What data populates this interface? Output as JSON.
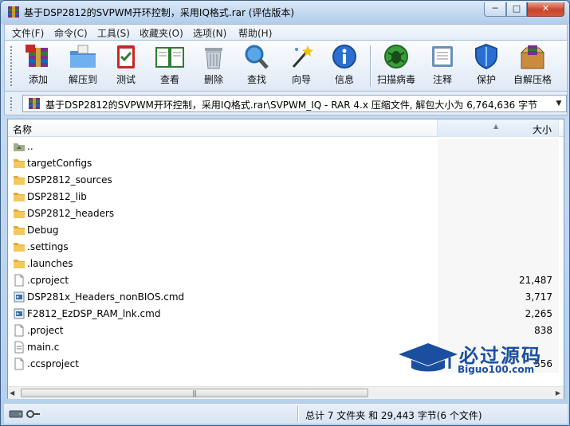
{
  "window": {
    "title": "基于DSP2812的SVPWM开环控制，采用IQ格式.rar (评估版本)",
    "controls": {
      "minimize": "─",
      "maximize": "□",
      "close": "✕"
    }
  },
  "menu": [
    "文件(F)",
    "命令(C)",
    "工具(S)",
    "收藏夹(O)",
    "选项(N)",
    "帮助(H)"
  ],
  "toolbar": [
    {
      "label": "添加",
      "icon": "add-archive-icon"
    },
    {
      "label": "解压到",
      "icon": "extract-folder-icon"
    },
    {
      "label": "测试",
      "icon": "test-clipboard-icon"
    },
    {
      "label": "查看",
      "icon": "view-book-icon"
    },
    {
      "label": "删除",
      "icon": "trash-icon"
    },
    {
      "label": "查找",
      "icon": "search-icon"
    },
    {
      "label": "向导",
      "icon": "wizard-wand-icon"
    },
    {
      "label": "信息",
      "icon": "info-icon"
    },
    {
      "label": "扫描病毒",
      "icon": "virus-scan-icon"
    },
    {
      "label": "注释",
      "icon": "comment-icon"
    },
    {
      "label": "保护",
      "icon": "shield-icon"
    },
    {
      "label": "自解压格",
      "icon": "sfx-box-icon"
    }
  ],
  "address": {
    "path": "基于DSP2812的SVPWM开环控制，采用IQ格式.rar\\SVPWM_IQ - RAR 4.x 压缩文件, 解包大小为 6,764,636 字节",
    "dropdown": "▼"
  },
  "columns": {
    "name": "名称",
    "size": "大小",
    "sort_indicator": "▲"
  },
  "files": [
    {
      "name": "..",
      "size": "",
      "type": "parent"
    },
    {
      "name": "targetConfigs",
      "size": "",
      "type": "folder"
    },
    {
      "name": "DSP2812_sources",
      "size": "",
      "type": "folder"
    },
    {
      "name": "DSP2812_lib",
      "size": "",
      "type": "folder"
    },
    {
      "name": "DSP2812_headers",
      "size": "",
      "type": "folder"
    },
    {
      "name": "Debug",
      "size": "",
      "type": "folder"
    },
    {
      "name": ".settings",
      "size": "",
      "type": "folder"
    },
    {
      "name": ".launches",
      "size": "",
      "type": "folder"
    },
    {
      "name": ".cproject",
      "size": "21,487",
      "type": "file"
    },
    {
      "name": "DSP281x_Headers_nonBIOS.cmd",
      "size": "3,717",
      "type": "cmd"
    },
    {
      "name": "F2812_EzDSP_RAM_lnk.cmd",
      "size": "2,265",
      "type": "cmd"
    },
    {
      "name": ".project",
      "size": "838",
      "type": "file"
    },
    {
      "name": "main.c",
      "size": "",
      "type": "cfile"
    },
    {
      "name": ".ccsproject",
      "size": "556",
      "type": "file"
    }
  ],
  "scrollbar": {
    "left_arrow": "◀",
    "right_arrow": "▶",
    "thumb_grip": "|||"
  },
  "status": {
    "summary": "总计 7 文件夹 和 29,443 字节(6 个文件)"
  },
  "watermark": {
    "title": "必过源码",
    "subtitle": "Biguo100.com",
    "color": "#1a4fa0"
  },
  "colors": {
    "titlebar": "#c2d8f1",
    "close_button": "#c8452c",
    "folder": "#f0c14b"
  }
}
